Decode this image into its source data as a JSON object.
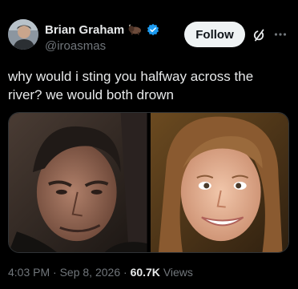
{
  "author": {
    "display_name": "Brian Graham",
    "handle": "@iroasmas",
    "avatar_icon": "avatar-photo",
    "name_emoji_icon": "bison-emoji-icon",
    "verified_icon": "verified-badge-icon"
  },
  "actions": {
    "follow_label": "Follow",
    "grok_icon": "grok-icon",
    "more_icon": "more-icon"
  },
  "tweet": {
    "text": "why would i sting you halfway across the river? we would both drown"
  },
  "media": [
    {
      "description": "man-smirking-photo"
    },
    {
      "description": "woman-smiling-photo"
    }
  ],
  "meta": {
    "time": "4:03 PM",
    "separator": "·",
    "date": "Sep 8, 2026",
    "views_count": "60.7K",
    "views_label": "Views"
  },
  "colors": {
    "background": "#000000",
    "text_primary": "#e7e9ea",
    "text_secondary": "#71767b",
    "verified": "#1d9bf0",
    "follow_button_bg": "#eff3f4"
  }
}
